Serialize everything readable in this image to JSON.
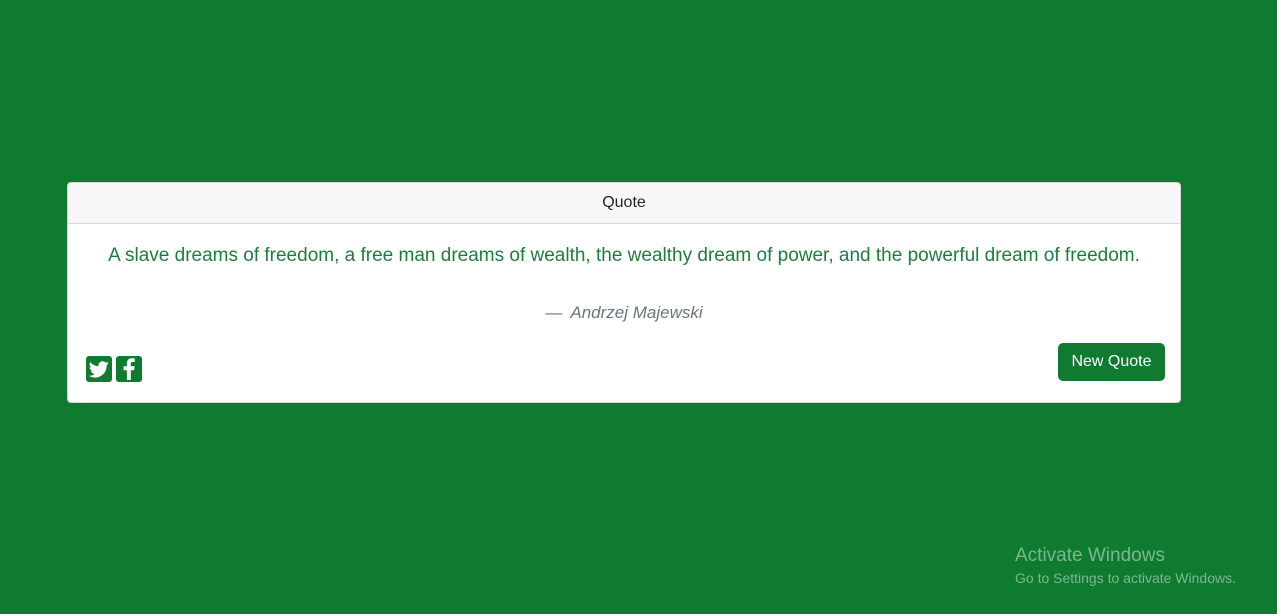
{
  "card": {
    "header": "Quote",
    "quote_text": "A slave dreams of freedom, a free man dreams of wealth, the wealthy dream of power, and the powerful dream of freedom.",
    "author_dash": "—",
    "author": "Andrzej Majewski",
    "new_quote_label": "New Quote",
    "share_icons": [
      "twitter-icon",
      "facebook-icon"
    ]
  },
  "watermark": {
    "title": "Activate Windows",
    "subtitle": "Go to Settings to activate Windows."
  },
  "colors": {
    "background": "#0f7b30",
    "quote_text": "#1e7d3c",
    "author": "#6c757d",
    "button": "#0f7b30"
  }
}
